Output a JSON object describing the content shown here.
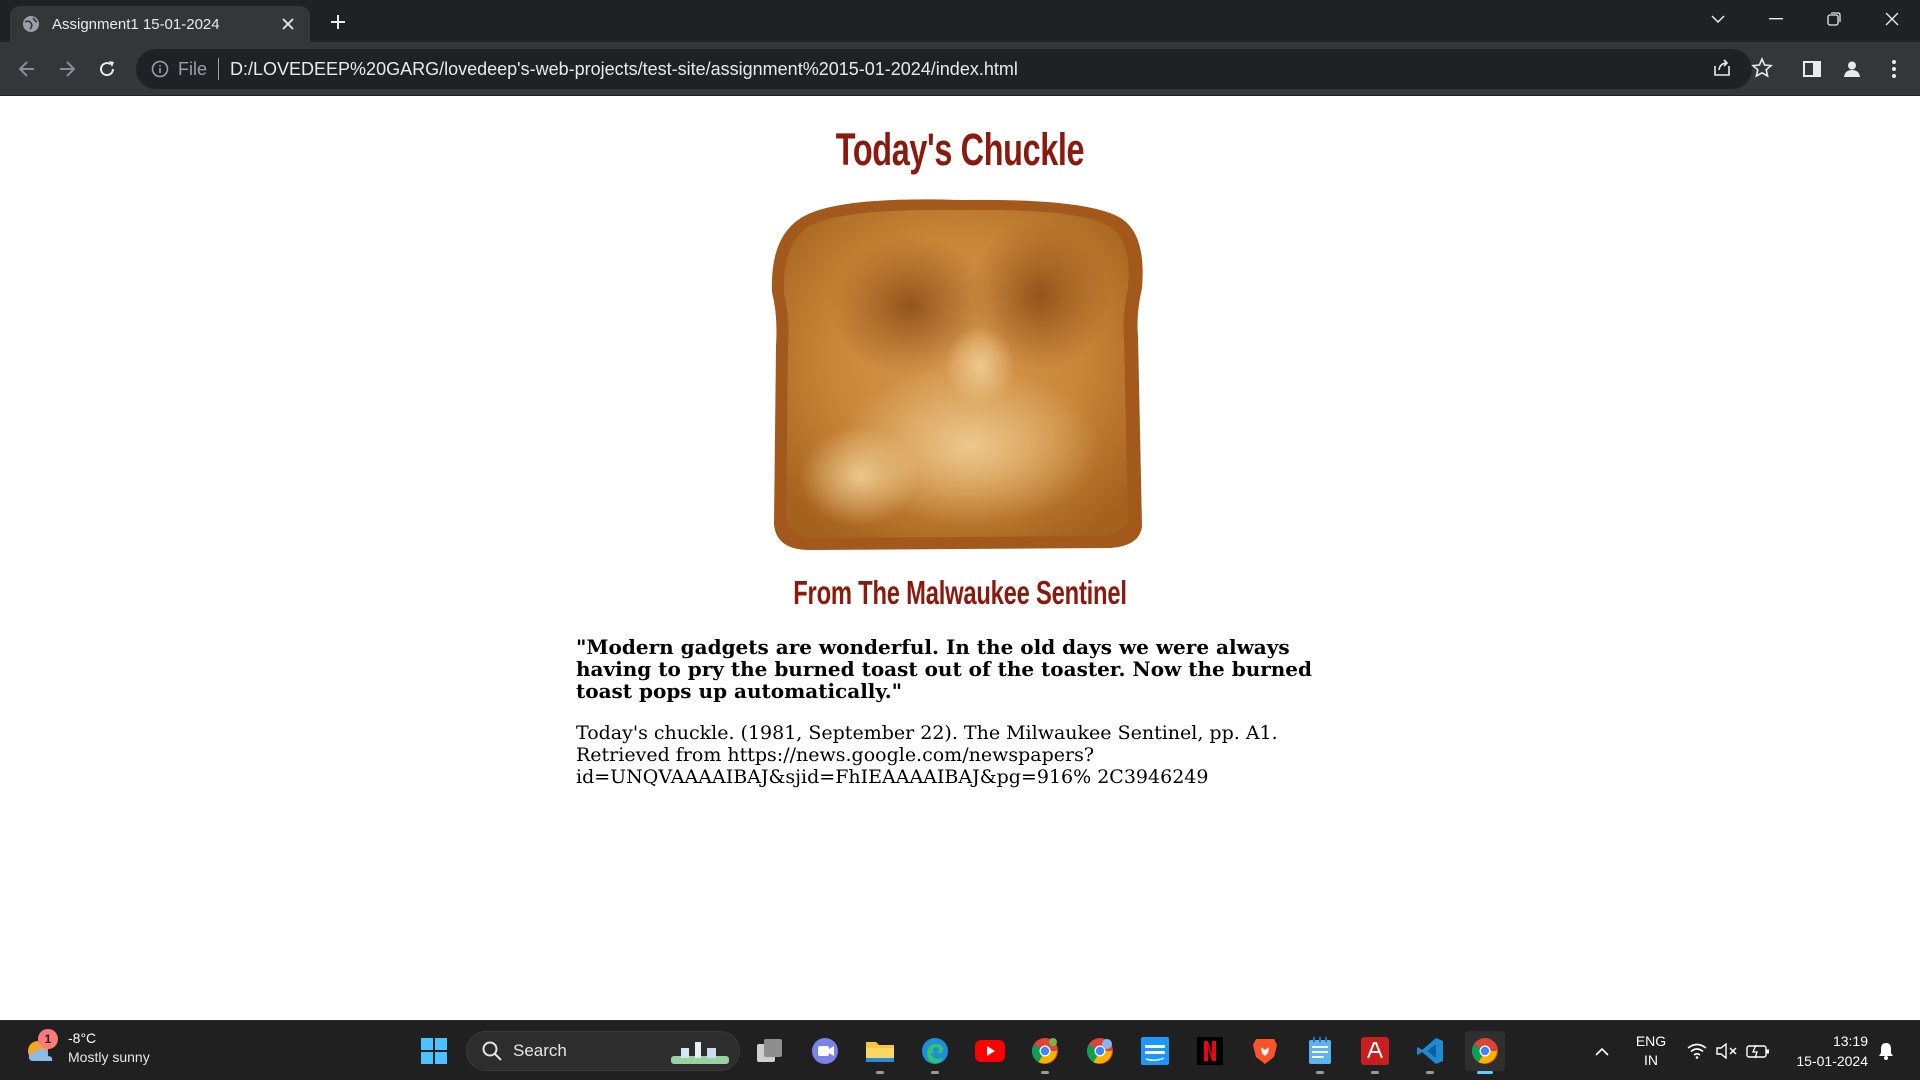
{
  "browser": {
    "tab": {
      "title": "Assignment1 15-01-2024",
      "favicon": "globe-icon"
    },
    "omnibox": {
      "scheme_label": "File",
      "url": "D:/LOVEDEEP%20GARG/lovedeep's-web-projects/test-site/assignment%2015-01-2024/index.html"
    }
  },
  "page": {
    "heading": "Today's Chuckle",
    "subheading": "From The Malwaukee Sentinel",
    "quote": "\"Modern gadgets are wonderful. In the old days we were always having to pry the burned toast out of the toaster. Now the burned toast pops up automatically.\"",
    "citation": "Today's chuckle. (1981, September 22). The Milwaukee Sentinel, pp. A1. Retrieved from https://news.google.com/newspapers?id=UNQVAAAAIBAJ&sjid=FhIEAAAAIBAJ&pg=916% 2C3946249"
  },
  "taskbar": {
    "weather": {
      "badge": "1",
      "temperature": "-8°C",
      "condition": "Mostly sunny"
    },
    "search_label": "Search",
    "language": {
      "line1": "ENG",
      "line2": "IN"
    },
    "clock": {
      "time": "13:19",
      "date": "15-01-2024"
    },
    "apps": [
      "start",
      "search",
      "task-view",
      "teams-chat",
      "file-explorer",
      "edge",
      "youtube",
      "chrome-profile",
      "chrome-canary",
      "prime-video",
      "netflix",
      "brave",
      "notepad",
      "adobe-acrobat",
      "vscode",
      "chrome"
    ]
  },
  "colors": {
    "heading": "#8b1a0e",
    "accent": "#60cdff"
  }
}
